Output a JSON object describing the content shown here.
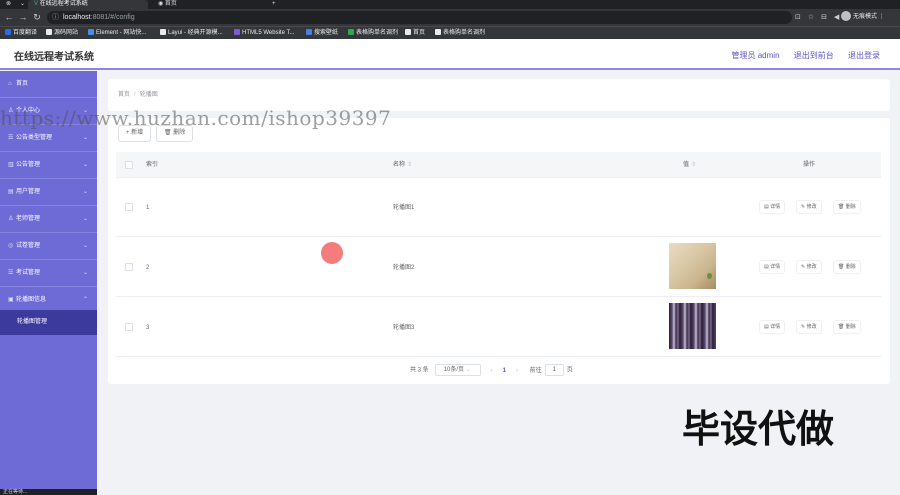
{
  "browser": {
    "tabs": [
      {
        "label": "在线远程考试系统"
      },
      {
        "label": "首页"
      }
    ],
    "new_tab": "+",
    "url_host": "localhost",
    "url_path": ":8081/#/config",
    "profile": "无痕模式",
    "bookmarks": [
      {
        "label": "百度翻译",
        "color": "#2b6de5"
      },
      {
        "label": "源码网站",
        "color": "#e8eaed"
      },
      {
        "label": "Element - 网站快...",
        "color": "#4a90e2"
      },
      {
        "label": "Layui - 经典开源模...",
        "color": "#e8eaed"
      },
      {
        "label": "HTML5 Website T...",
        "color": "#7b5cd6"
      },
      {
        "label": "搜索壁纸",
        "color": "#4a7ee0"
      },
      {
        "label": "表格购单名调剂",
        "color": "#2fa84f"
      },
      {
        "label": "首页",
        "color": "#e8eaed"
      },
      {
        "label": "表格购单名调剂",
        "color": "#e8eaed"
      }
    ]
  },
  "header": {
    "title": "在线远程考试系统",
    "admin": "管理员 admin",
    "front": "退出到前台",
    "logout": "退出登录"
  },
  "sidebar": {
    "items": [
      {
        "icon": "⌂",
        "label": "首页",
        "has_arrow": false
      },
      {
        "icon": "♙",
        "label": "个人中心",
        "has_arrow": true
      },
      {
        "icon": "☰",
        "label": "公告类型管理",
        "has_arrow": true
      },
      {
        "icon": "▥",
        "label": "公告管理",
        "has_arrow": true
      },
      {
        "icon": "▤",
        "label": "用户管理",
        "has_arrow": true
      },
      {
        "icon": "♙",
        "label": "老师管理",
        "has_arrow": true
      },
      {
        "icon": "◎",
        "label": "试卷管理",
        "has_arrow": true
      },
      {
        "icon": "☰",
        "label": "考试管理",
        "has_arrow": true
      },
      {
        "icon": "▣",
        "label": "轮播图信息",
        "has_arrow": true
      }
    ],
    "sub_item": "轮播图管理",
    "footer": "正在等待..."
  },
  "breadcrumb": {
    "home": "首页",
    "current": "轮播图"
  },
  "toolbar": {
    "add": "+ 新增",
    "delete": "🗑 删除"
  },
  "table": {
    "headers": {
      "index": "索引",
      "name": "名称",
      "value": "值",
      "actions": "操作"
    },
    "rows": [
      {
        "index": "1",
        "name": "轮播图1",
        "image": "none"
      },
      {
        "index": "2",
        "name": "轮播图2",
        "image": "beige-room"
      },
      {
        "index": "3",
        "name": "轮播图3",
        "image": "purple-stripes"
      }
    ],
    "actions": {
      "detail": "详情",
      "edit": "修改",
      "delete": "删除"
    }
  },
  "pager": {
    "total": "共 3 条",
    "size": "10条/页",
    "page": "1",
    "goto": "前往",
    "goto_value": "1",
    "unit": "页"
  },
  "watermark": "https://www.huzhan.com/ishop39397",
  "overlay_text": "毕设代做",
  "colors": {
    "accent": "#6e6ad6",
    "sidebar_active": "#3d3a9e",
    "link": "#5b55c8"
  }
}
